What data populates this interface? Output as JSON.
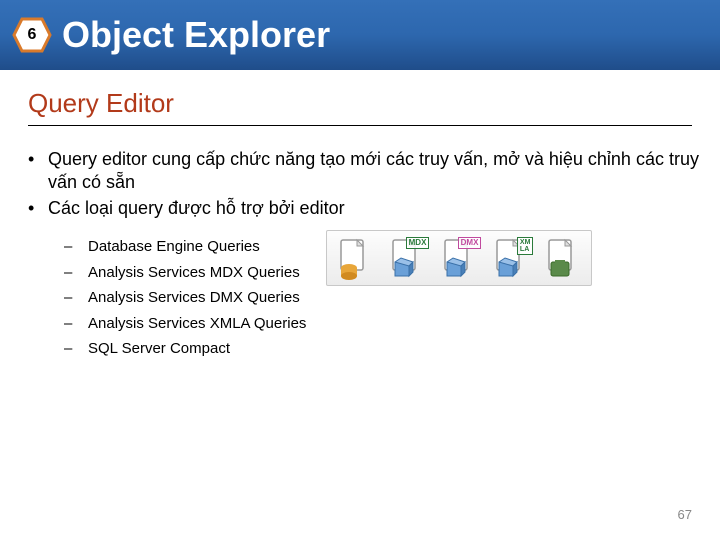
{
  "header": {
    "number": "6",
    "title": "Object Explorer"
  },
  "subtitle": "Query Editor",
  "bullets": [
    "Query editor cung cấp chức năng tạo mới các truy vấn, mở và hiệu chỉnh các truy vấn có sẵn",
    "Các loại query được hỗ trợ bởi editor"
  ],
  "subitems": [
    "Database Engine Queries",
    "Analysis Services MDX Queries",
    "Analysis Services DMX Queries",
    "Analysis Services XMLA Queries",
    "SQL Server Compact"
  ],
  "icons": {
    "tags": {
      "mdx": "MDX",
      "dmx": "DMX",
      "xmla": "XM\nLA"
    }
  },
  "pageNumber": "67"
}
